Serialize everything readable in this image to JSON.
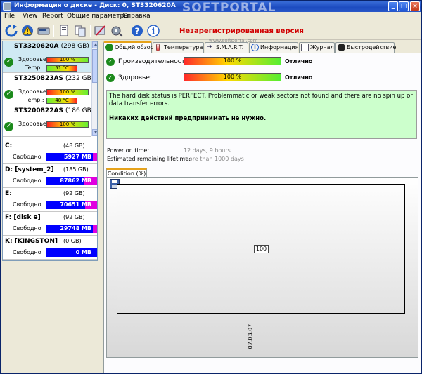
{
  "window": {
    "title": "Информация о диске - Диск: 0, ST3320620A",
    "watermark": "SOFTPORTAL",
    "watermark_url": "www.softportal.com"
  },
  "menu": [
    "File",
    "View",
    "Report",
    "Общие параметры",
    "Справка"
  ],
  "toolbar": {
    "icons": [
      "refresh-icon",
      "warning-icon",
      "disk-icon",
      "document-icon",
      "copy-icon",
      "settings-icon",
      "tools-icon",
      "help-icon",
      "info-icon"
    ],
    "unregistered": "Незарегистрированная версия"
  },
  "disks": [
    {
      "name": "ST3320620A",
      "size": "(298 GB)",
      "health_label": "Здоровье:",
      "health": "100 %",
      "health_pct": 100,
      "temp_label": "Temp.:",
      "temp": "51 °C",
      "selected": true
    },
    {
      "name": "ST3250823AS",
      "size": "(232 GB)",
      "health_label": "Здоровье:",
      "health": "100 %",
      "health_pct": 100,
      "temp_label": "Temp.:",
      "temp": "48 °C",
      "selected": false
    },
    {
      "name": "ST3200822AS",
      "size": "(186 GB)",
      "health_label": "Здоровье:",
      "health": "100 %",
      "health_pct": 100,
      "selected": false
    }
  ],
  "volumes": [
    {
      "name": "C:",
      "size": "(48 GB)",
      "free_label": "Свободно",
      "free": "5927 MB"
    },
    {
      "name": "D: [system_2]",
      "size": "(185 GB)",
      "free_label": "Свободно",
      "free": "87862 MB"
    },
    {
      "name": "E:",
      "size": "(92 GB)",
      "free_label": "Свободно",
      "free": "70651 MB"
    },
    {
      "name": "F: [disk e]",
      "size": "(92 GB)",
      "free_label": "Свободно",
      "free": "29748 MB"
    },
    {
      "name": "K: [KINGSTON]",
      "size": "(0 GB)",
      "free_label": "Свободно",
      "free": "0 MB"
    }
  ],
  "tabs": [
    "Общий обзор",
    "Температура",
    "S.M.A.R.T.",
    "Информация",
    "Журнал",
    "Быстродействие"
  ],
  "overview": {
    "performance_label": "Производительность:",
    "performance_value": "100 %",
    "performance_pct": 100,
    "performance_status": "Отлично",
    "health_label": "Здоровье:",
    "health_value": "100 %",
    "health_pct": 100,
    "health_status": "Отлично",
    "message": "The hard disk status is PERFECT. Problemmatic or weak sectors not found and there are no spin up or data transfer errors.",
    "message_action": "Никаких действий предпринимать не нужно.",
    "power_on_label": "Power on time:",
    "power_on_value": "12 days, 9 hours",
    "lifetime_label": "Estimated remaining lifetime:",
    "lifetime_value": "more than 1000 days"
  },
  "chart_tab": "Condition (%)",
  "chart_data": {
    "type": "line",
    "x": [
      "07.03.07"
    ],
    "series": [
      {
        "values": [
          100
        ]
      }
    ],
    "xlabel": "",
    "ylabel": "",
    "ylim": [
      0,
      200
    ]
  }
}
